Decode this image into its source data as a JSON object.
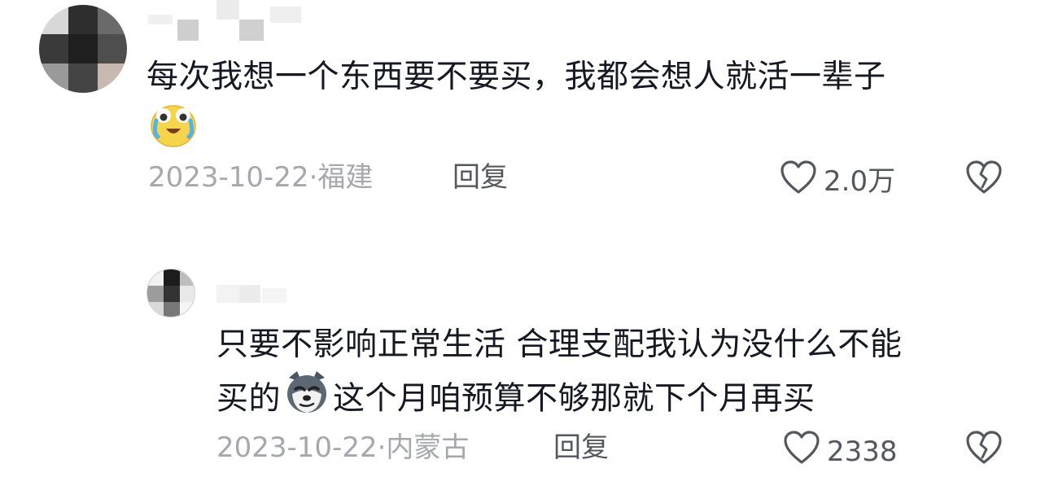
{
  "comments": [
    {
      "text_line1": "每次我想一个东西要不要买，我都会想人就活一辈子",
      "emoji": "crying-laughing-emoji",
      "date": "2023-10-22",
      "location": "福建",
      "reply_label": "回复",
      "like_count": "2.0万"
    },
    {
      "text_line1": "只要不影响正常生活 合理支配我认为没什么不能",
      "text_line2_before": "买的",
      "emoji": "smirking-dog-emoji",
      "text_line2_after": "这个月咱预算不够那就下个月再买",
      "date": "2023-10-22",
      "location": "内蒙古",
      "reply_label": "回复",
      "like_count": "2338"
    }
  ],
  "separator": "·",
  "colors": {
    "primary_text": "#161823",
    "meta_text": "#a7a8ad",
    "action_text": "#55575e"
  }
}
